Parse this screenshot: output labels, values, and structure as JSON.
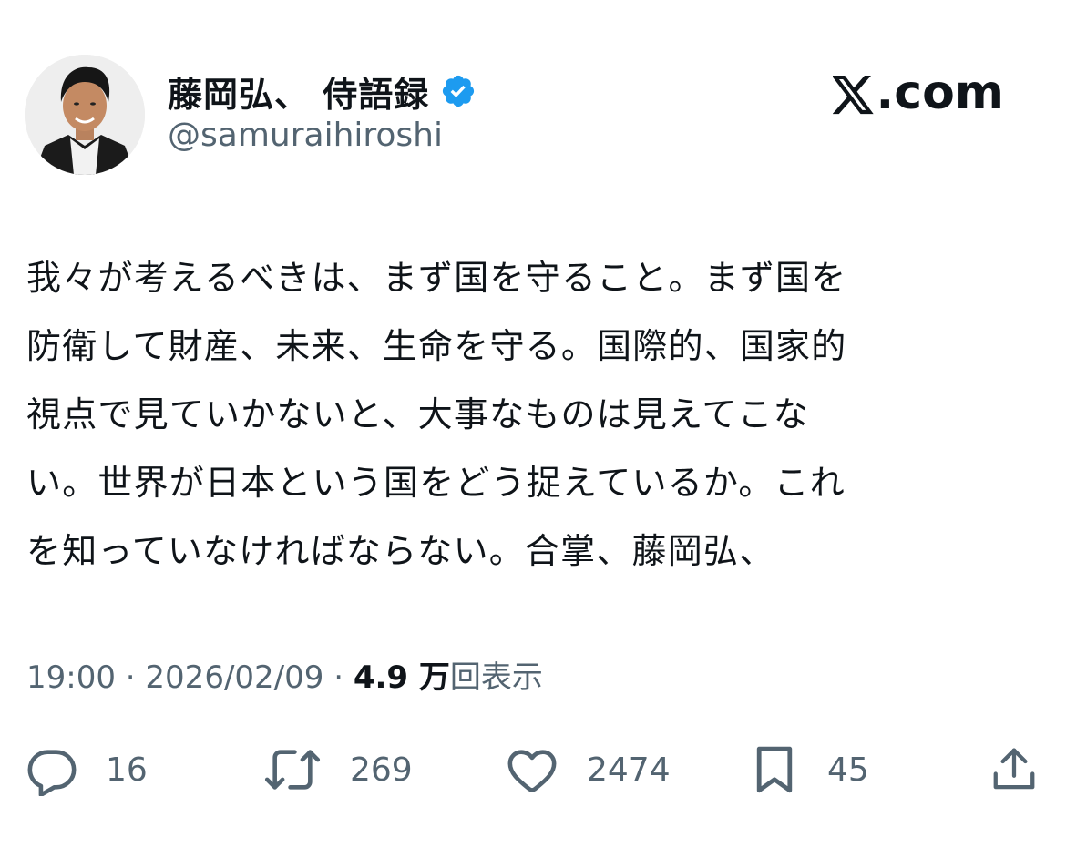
{
  "author": {
    "display_name": "藤岡弘、 侍語録",
    "handle": "@samuraihiroshi",
    "verified": true,
    "avatar_icon": "profile-photo"
  },
  "site": {
    "logo_text": ".com",
    "logo_icon": "x-logo-icon"
  },
  "tweet": {
    "lines": [
      "我々が考えるべきは、まず国を守ること。まず国を",
      "防衛して財産、未来、生命を守る。国際的、国家的",
      "視点で見ていかないと、大事なものは見えてこな",
      "い。世界が日本という国をどう捉えているか。これ",
      "を知っていなければならない。合掌、藤岡弘、"
    ]
  },
  "meta": {
    "time": "19:00",
    "separator": " · ",
    "date": "2026/02/09",
    "views_count": "4.9 万",
    "views_label": "回表示"
  },
  "actions": {
    "reply": {
      "icon": "reply-icon",
      "count": "16"
    },
    "repost": {
      "icon": "repost-icon",
      "count": "269"
    },
    "like": {
      "icon": "heart-icon",
      "count": "2474"
    },
    "bookmark": {
      "icon": "bookmark-icon",
      "count": "45"
    },
    "share": {
      "icon": "share-icon"
    }
  },
  "colors": {
    "text_primary": "#0f1419",
    "text_secondary": "#536471",
    "verified_blue": "#1d9bf0"
  }
}
